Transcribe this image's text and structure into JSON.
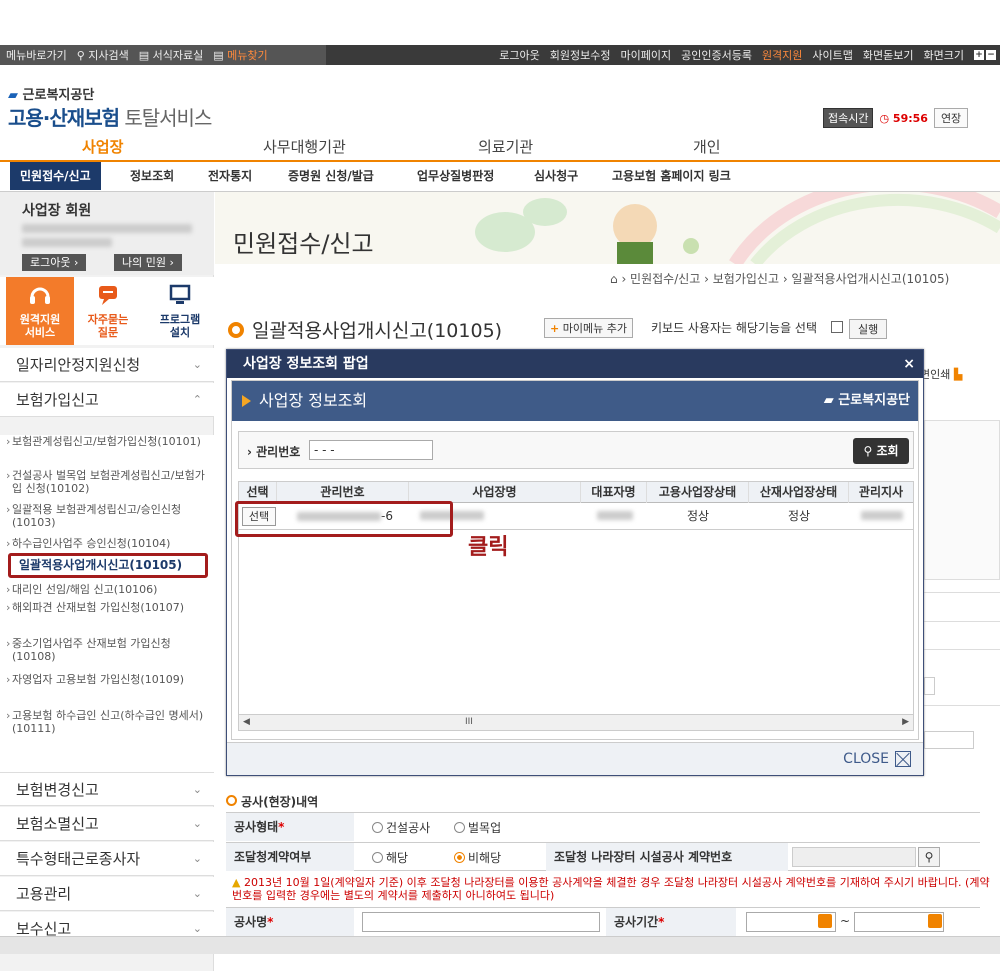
{
  "util_bar": {
    "left": [
      "메뉴바로가기",
      "지사검색",
      "서식자료실",
      "메뉴찾기"
    ],
    "right": [
      "로그아웃",
      "회원정보수정",
      "마이페이지",
      "공인인증서등록",
      "원격지원",
      "사이트맵",
      "화면돋보기",
      "화면크기"
    ],
    "size_plus": "+",
    "size_minus": "−"
  },
  "header": {
    "org": "근로복지공단",
    "service_main": "고용·산재보험",
    "service_sub": " 토탈서비스",
    "session_label": "접속시간",
    "session_time": "59:56",
    "extend": "연장"
  },
  "main_nav": [
    "사업장",
    "사무대행기관",
    "의료기관",
    "개인"
  ],
  "sub_nav": [
    "민원접수/신고",
    "정보조회",
    "전자통지",
    "증명원 신청/발급",
    "업무상질병판정",
    "심사청구",
    "고용보험 홈페이지 링크"
  ],
  "sidebar": {
    "member_title": "사업장 회원",
    "logout": "로그아웃",
    "my_civil": "나의 민원",
    "quick": [
      {
        "l1": "원격지원",
        "l2": "서비스"
      },
      {
        "l1": "자주묻는",
        "l2": "질문"
      },
      {
        "l1": "프로그램",
        "l2": "설치"
      }
    ],
    "menu_jobs": "일자리안정지원신청",
    "menu_insurance": "보험가입신고",
    "items": [
      "보험관계성립신고/보험가입신청(10101)",
      "건설공사 벌목업 보험관계성립신고/보험가입 신청(10102)",
      "일괄적용 보험관계성립신고/승인신청(10103)",
      "하수급인사업주 승인신청(10104)",
      "일괄적용사업개시신고(10105)",
      "대리인 선임/해임 신고(10106)",
      "해외파견 산재보험 가입신청(10107)",
      "중소기업사업주 산재보험 가입신청(10108)",
      "자영업자 고용보험 가입신청(10109)",
      "고용보험 하수급인 신고(하수급인 명세서)(10111)"
    ],
    "bottom_menus": [
      "보험변경신고",
      "보험소멸신고",
      "특수형태근로종사자",
      "고용관리",
      "보수신고"
    ]
  },
  "content": {
    "banner_title": "민원접수/신고",
    "breadcrumb": "› 민원접수/신고 › 보험가입신고 › 일괄적용사업개시신고(10105)",
    "page_title": "일괄적용사업개시신고(10105)",
    "add_menu": "마이메뉴 추가",
    "add_plus": "+",
    "keyboard_text": "키보드 사용자는 해당기능을 선택",
    "run": "실행",
    "print": "면인쇄",
    "section_title": "공사(현장)내역",
    "form": {
      "work_type_label": "공사형태",
      "opt_construction": "건설공사",
      "opt_logging": "벌목업",
      "procure_label": "조달청계약여부",
      "opt_yes": "해당",
      "opt_no": "비해당",
      "nara_label": "조달청 나라장터 시설공사 계약번호",
      "warning": "2013년 10월 1일(계약일자 기준) 이후 조달청 나라장터를 이용한 공사계약을 체결한 경우 조달청 나라장터 시설공사 계약번호를 기재하여 주시기 바랍니다. (계약번호를 입력한 경우에는 별도의 계약서를 제출하지 아니하여도 됩니다)",
      "work_name_label": "공사명",
      "period_label": "공사기간",
      "tilde": "~"
    }
  },
  "popup": {
    "title": "사업장 정보조회 팝업",
    "close_x": "×",
    "banner": "사업장 정보조회",
    "banner_logo": "근로복지공단",
    "search_label": "관리번호",
    "search_value": "-  -  -",
    "search_button": "조회",
    "columns": [
      "선택",
      "관리번호",
      "사업장명",
      "대표자명",
      "고용사업장상태",
      "산재사업장상태",
      "관리지사"
    ],
    "row": {
      "select": "선택",
      "mgmt_suffix": "-6",
      "emp_status": "정상",
      "ind_status": "정상"
    },
    "annotation": "클릭",
    "scroll_mark": "III",
    "close": "CLOSE"
  }
}
